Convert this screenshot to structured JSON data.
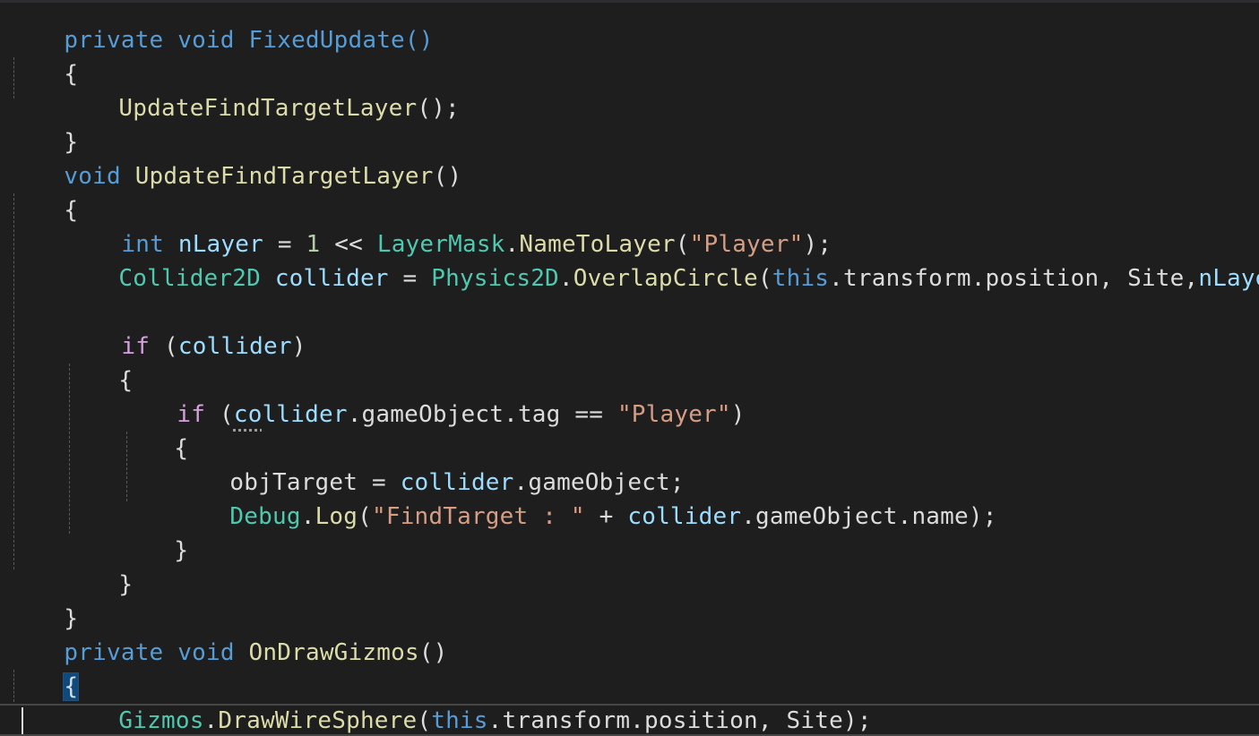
{
  "editor": {
    "lines": [
      [
        "private void FixedUpdate()"
      ],
      [
        "{"
      ],
      [
        "UpdateFindTargetLayer",
        "();"
      ],
      [
        "}"
      ],
      [
        "void",
        "UpdateFindTargetLayer",
        "()"
      ],
      [
        "{"
      ],
      [
        "int",
        "nLayer",
        "=",
        "1",
        "<<",
        "LayerMask",
        ".",
        "NameToLayer",
        "(",
        "\"Player\"",
        ");"
      ],
      [
        "Collider2D",
        "collider",
        "=",
        "Physics2D",
        ".",
        "OverlapCircle",
        "(",
        "this",
        ".transform.position, Site,",
        "nLayer",
        ");"
      ],
      [
        ""
      ],
      [
        "if",
        "(",
        "collider",
        ")"
      ],
      [
        "{"
      ],
      [
        "if",
        "(",
        "co",
        "llider",
        ".gameObject.tag ==",
        "\"Player\"",
        ")"
      ],
      [
        "{"
      ],
      [
        "objTarget",
        "=",
        "collider",
        ".gameObject;"
      ],
      [
        "Debug",
        ".",
        "Log",
        "(",
        "\"FindTarget : \"",
        "+",
        "collider",
        ".gameObject.name);"
      ],
      [
        "}"
      ],
      [
        "}"
      ],
      [
        "}"
      ],
      [
        "private",
        "void",
        "OnDrawGizmos",
        "()"
      ],
      [
        "{"
      ],
      [
        "Gizmos",
        ".",
        "DrawWireSphere",
        "(",
        "this",
        ".transform.position, Site);"
      ],
      [
        "}"
      ]
    ]
  },
  "colors": {
    "background": "#1e1e1e",
    "keyword": "#569cd6",
    "control": "#d8a0df",
    "type": "#4ec9b0",
    "method": "#dcdcaa",
    "string": "#d69d85",
    "variable": "#9cdcfe",
    "number": "#b5cea8"
  }
}
